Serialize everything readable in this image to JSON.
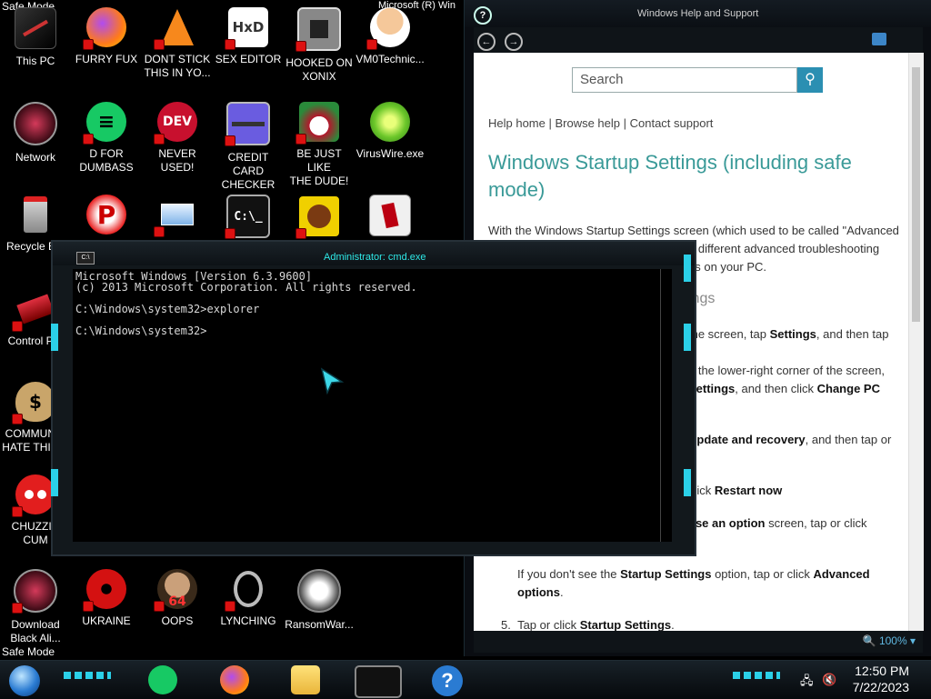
{
  "safe_mode_top": "Safe Mode",
  "safe_mode_bottom": "Safe Mode",
  "watermark": "Microsoft (R) Win",
  "desktop": {
    "icons": [
      {
        "label": "This PC"
      },
      {
        "label": "FURRY FUX"
      },
      {
        "label": "DONT STICK\nTHIS IN YO..."
      },
      {
        "label": "SEX EDITOR"
      },
      {
        "label": "HOOKED ON\nXONIX"
      },
      {
        "label": "VM0Technic..."
      },
      {
        "label": "Network"
      },
      {
        "label": "D FOR\nDUMBASS"
      },
      {
        "label": "NEVER USED!"
      },
      {
        "label": "CREDIT CARD\nCHECKER"
      },
      {
        "label": "BE JUST LIKE\nTHE DUDE!"
      },
      {
        "label": "VirusWire.exe"
      },
      {
        "label": "Recycle B..."
      },
      {
        "label": "Control Par"
      },
      {
        "label": "COMMUNIS\nHATE THIS C"
      },
      {
        "label": "CHUZZIN\nCUM"
      },
      {
        "label": "Download\nBlack Ali..."
      },
      {
        "label": "UKRAINE"
      },
      {
        "label": "OOPS"
      },
      {
        "label": "LYNCHING"
      },
      {
        "label": "RansomWar..."
      }
    ],
    "icon_glyphs": {
      "dev": "DEV",
      "hxd": "HxD",
      "oops_num": "64",
      "cmd": "C:\\_",
      "p": "P"
    }
  },
  "help_window": {
    "title": "Windows Help and Support",
    "search_placeholder": "Search",
    "links": "Help home | Browse help | Contact support",
    "heading": "Windows Startup Settings (including safe mode)",
    "intro": "With the Windows Startup Settings screen (which used to be called \"Advanced",
    "intro2": "n different advanced troubleshooting",
    "intro3": "ns on your PC.",
    "subheading": "ings",
    "step_a": "the screen, tap ",
    "step_a_b": "Settings",
    "step_a_c": ", and then tap",
    "step_b": "p the lower-right corner of the screen,",
    "step_b2_b": "Settings",
    "step_b2": ", and then click ",
    "step_b2_c": "Change PC",
    "step_c_b": "Update and recovery",
    "step_c": ", and then tap or",
    "step_d": "click ",
    "step_d_b": "Restart now",
    "step_e_b": "ose an option",
    "step_e": " screen, tap or click",
    "note_a": "If you don't see the ",
    "note_b": "Startup Settings",
    "note_c": " option, tap or click ",
    "note_d": "Advanced",
    "note_e": "options",
    "step5_num": "5.",
    "step5_a": "Tap or click ",
    "step5_b": "Startup Settings",
    "zoom": "100%"
  },
  "cmd_window": {
    "title": "Administrator: cmd.exe",
    "lines": "Microsoft Windows [Version 6.3.9600]\n(c) 2013 Microsoft Corporation. All rights reserved.\n\nC:\\Windows\\system32>explorer\n\nC:\\Windows\\system32>"
  },
  "taskbar": {
    "time": "12:50 PM",
    "date": "7/22/2023"
  },
  "colors": {
    "accent": "#2bd0e8",
    "help_heading": "#3a9a98",
    "search_button": "#2b8fb2"
  }
}
